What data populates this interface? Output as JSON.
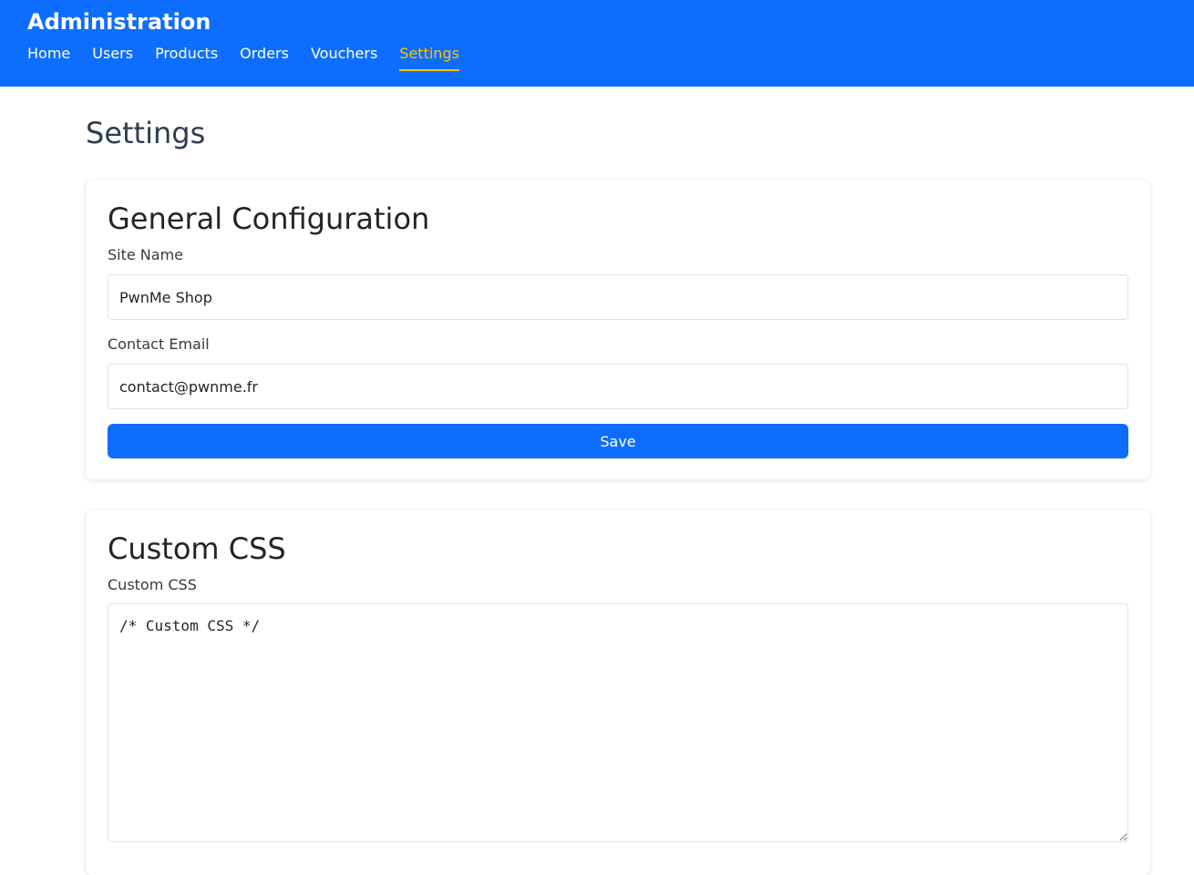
{
  "header": {
    "brand": "Administration",
    "nav": [
      {
        "label": "Home",
        "active": false
      },
      {
        "label": "Users",
        "active": false
      },
      {
        "label": "Products",
        "active": false
      },
      {
        "label": "Orders",
        "active": false
      },
      {
        "label": "Vouchers",
        "active": false
      },
      {
        "label": "Settings",
        "active": true
      }
    ]
  },
  "page": {
    "title": "Settings"
  },
  "general": {
    "heading": "General Configuration",
    "site_name": {
      "label": "Site Name",
      "value": "PwnMe Shop"
    },
    "contact_email": {
      "label": "Contact Email",
      "value": "contact@pwnme.fr"
    },
    "save_label": "Save"
  },
  "custom_css": {
    "heading": "Custom CSS",
    "label": "Custom CSS",
    "value": "/* Custom CSS */"
  },
  "colors": {
    "header_bg": "#0d6efd",
    "active_nav": "#ffc107",
    "primary_button": "#0d6efd"
  }
}
